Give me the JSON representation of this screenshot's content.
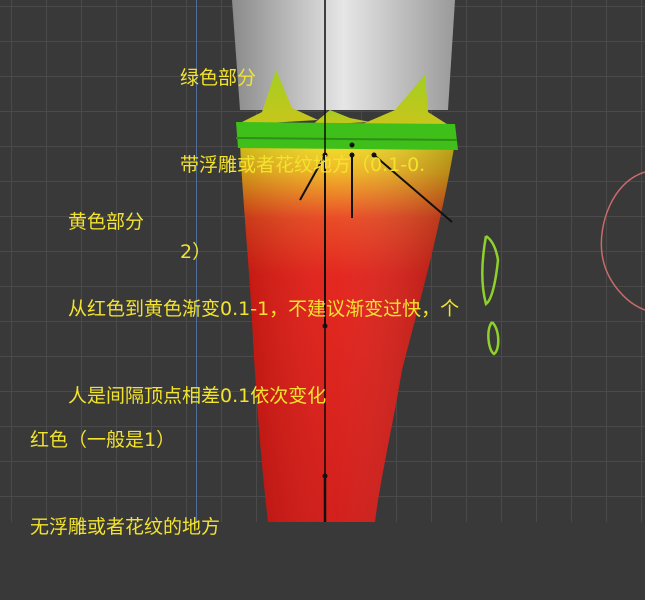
{
  "annotations": {
    "green": {
      "title": "绿色部分",
      "line1": "带浮雕或者花纹地方（0.1-0.",
      "line2": "2）"
    },
    "yellow": {
      "title": "黄色部分",
      "line1": "从红色到黄色渐变0.1-1，不建议渐变过快，个",
      "line2": "人是间隔顶点相差0.1依次变化"
    },
    "red": {
      "title": "红色（一般是1）",
      "line1": "无浮雕或者花纹的地方"
    }
  },
  "colors": {
    "text": "#f2e32e",
    "background": "#393939",
    "red_region": "#e8140f",
    "yellow_region": "#e9e21a",
    "green_band": "#3fbf1a",
    "sketch_stroke": "#8fd12a",
    "circle_stroke": "#c96a6a"
  }
}
